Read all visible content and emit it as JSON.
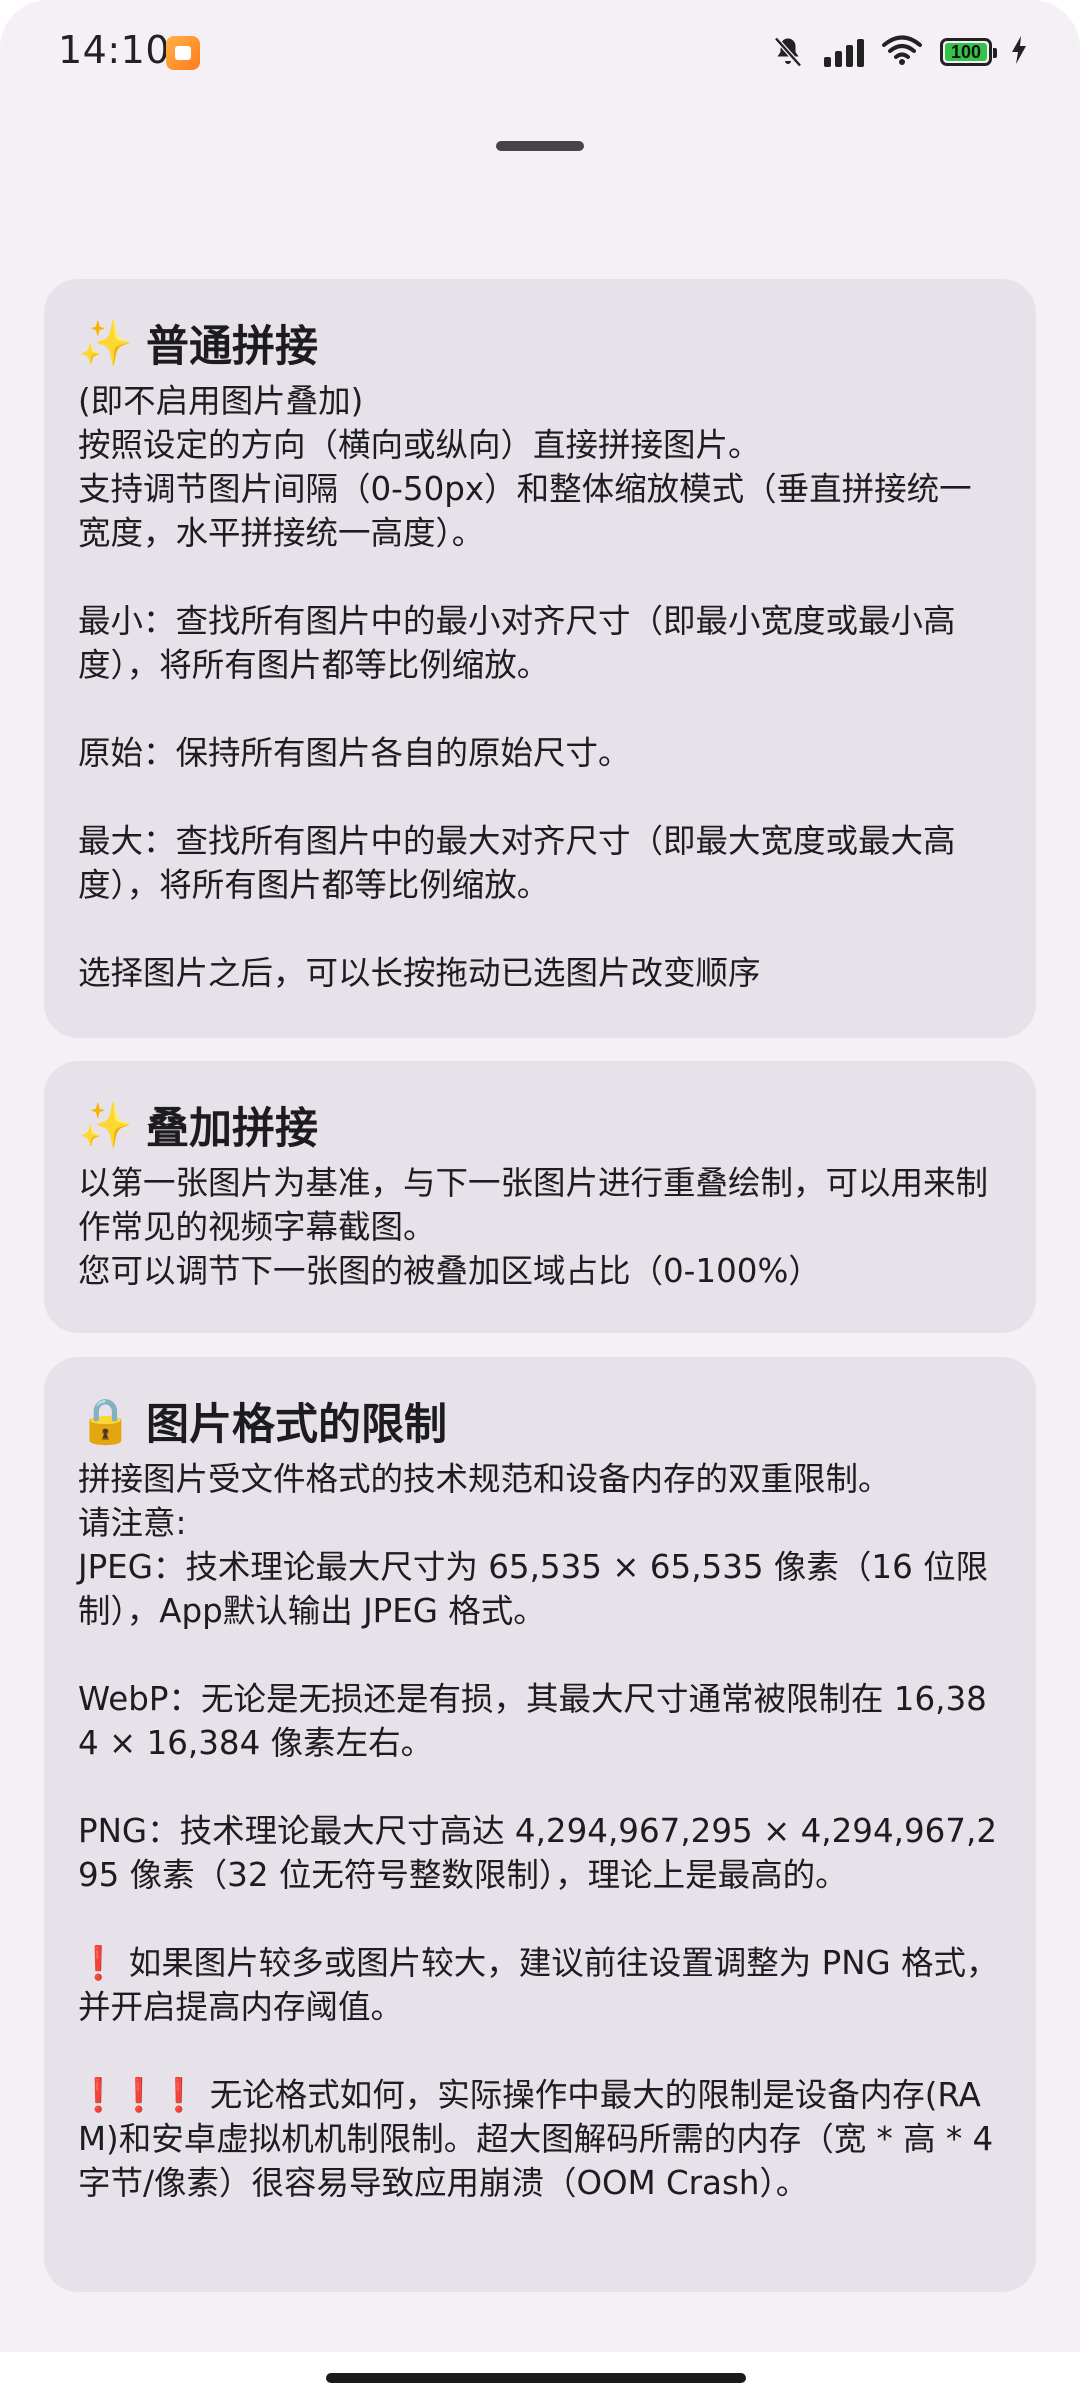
{
  "status_bar": {
    "time": "14:10",
    "battery_level": 100,
    "battery_text": "100",
    "icons": [
      "app-icon",
      "bell-off-icon",
      "signal-icon",
      "wifi-icon",
      "battery-icon",
      "charging-icon"
    ]
  },
  "cards": [
    {
      "emoji": "✨",
      "title": "普通拼接",
      "lines": [
        "(即不启用图片叠加)",
        "按照设定的方向（横向或纵向）直接拼接图片。",
        "支持调节图片间隔（0-50px）和整体缩放模式（垂直拼接统一宽度，水平拼接统一高度）。",
        "",
        "最小：查找所有图片中的最小对齐尺寸（即最小宽度或最小高度），将所有图片都等比例缩放。",
        "",
        "原始：保持所有图片各自的原始尺寸。",
        "",
        "最大：查找所有图片中的最大对齐尺寸（即最大宽度或最大高度），将所有图片都等比例缩放。",
        "",
        "选择图片之后，可以长按拖动已选图片改变顺序"
      ]
    },
    {
      "emoji": "✨",
      "title": "叠加拼接",
      "lines": [
        "以第一张图片为基准，与下一张图片进行重叠绘制，可以用来制作常见的视频字幕截图。",
        "您可以调节下一张图的被叠加区域占比（0-100%）"
      ]
    },
    {
      "emoji": "🔒",
      "title": "图片格式的限制",
      "lines": [
        "拼接图片受文件格式的技术规范和设备内存的双重限制。",
        "请注意:",
        "JPEG：技术理论最大尺寸为 65,535 × 65,535 像素（16 位限制），App默认输出 JPEG 格式。",
        "",
        "WebP：无论是无损还是有损，其最大尺寸通常被限制在 16,384 × 16,384 像素左右。",
        "",
        "PNG：技术理论最大尺寸高达 4,294,967,295 × 4,294,967,295 像素（32 位无符号整数限制），理论上是最高的。",
        "",
        "❗ 如果图片较多或图片较大，建议前往设置调整为 PNG 格式，并开启提高内存阈值。",
        "",
        "❗❗❗ 无论格式如何，实际操作中最大的限制是设备内存(RAM)和安卓虚拟机机制限制。超大图解码所需的内存（宽 * 高 * 4 字节/像素）很容易导致应用崩溃（OOM Crash）。"
      ]
    }
  ],
  "colors": {
    "sheet_bg": "#f5f0f6",
    "card_bg": "#e7e2e9",
    "text": "#1d1c20",
    "warning_red": "#d8221f",
    "battery_green": "#35c24b"
  }
}
